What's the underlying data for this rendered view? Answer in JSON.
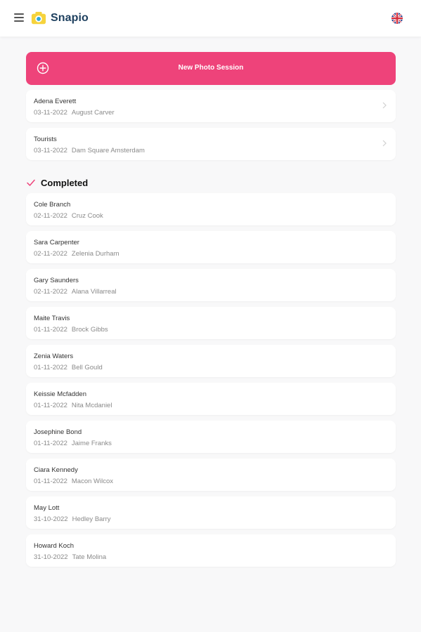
{
  "app": {
    "name": "Snapio",
    "accent_color": "#ee437a",
    "logo_color": "#1d3f5e",
    "language_icon": "uk-flag-icon"
  },
  "new_session_button": {
    "label": "New Photo Session",
    "icon": "plus-circle-icon"
  },
  "active_sessions": [
    {
      "name": "Adena Everett",
      "date": "03-11-2022",
      "detail": "August Carver"
    },
    {
      "name": "Tourists",
      "date": "03-11-2022",
      "detail": "Dam Square Amsterdam"
    }
  ],
  "completed_section": {
    "title": "Completed",
    "icon": "check-icon",
    "items": [
      {
        "name": "Cole Branch",
        "date": "02-11-2022",
        "detail": "Cruz Cook"
      },
      {
        "name": "Sara Carpenter",
        "date": "02-11-2022",
        "detail": "Zelenia Durham"
      },
      {
        "name": "Gary Saunders",
        "date": "02-11-2022",
        "detail": "Alana Villarreal"
      },
      {
        "name": "Maite Travis",
        "date": "01-11-2022",
        "detail": "Brock Gibbs"
      },
      {
        "name": "Zenia Waters",
        "date": "01-11-2022",
        "detail": "Bell Gould"
      },
      {
        "name": "Keissie Mcfadden",
        "date": "01-11-2022",
        "detail": "Nita Mcdaniel"
      },
      {
        "name": "Josephine Bond",
        "date": "01-11-2022",
        "detail": "Jaime Franks"
      },
      {
        "name": "Ciara Kennedy",
        "date": "01-11-2022",
        "detail": "Macon Wilcox"
      },
      {
        "name": "May Lott",
        "date": "31-10-2022",
        "detail": "Hedley Barry"
      },
      {
        "name": "Howard Koch",
        "date": "31-10-2022",
        "detail": "Tate Molina"
      }
    ]
  }
}
